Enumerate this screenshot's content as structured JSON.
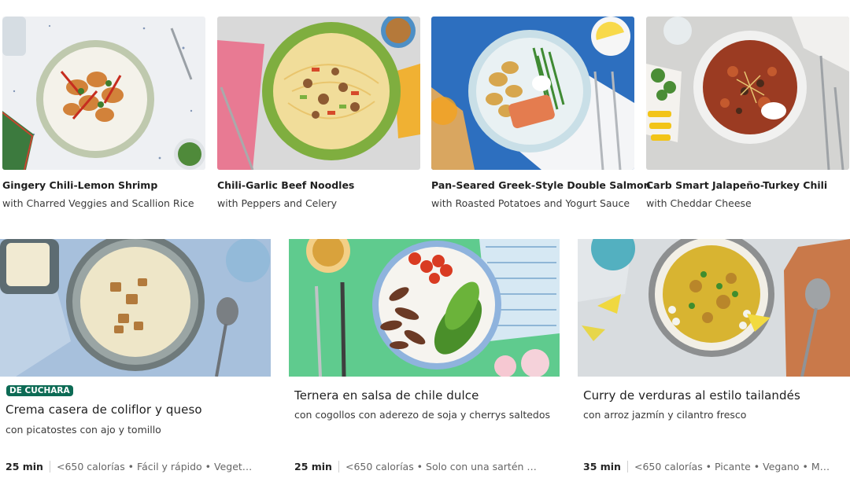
{
  "top_recipes": [
    {
      "title": "Gingery Chili-Lemon Shrimp",
      "subtitle": "with Charred Veggies and Scallion Rice"
    },
    {
      "title": "Chili-Garlic Beef Noodles",
      "subtitle": "with Peppers and Celery"
    },
    {
      "title": "Pan-Seared Greek-Style Double Salmon",
      "subtitle": "with Roasted Potatoes and Yogurt Sauce"
    },
    {
      "title": "Carb Smart Jalapeño-Turkey Chili",
      "subtitle": "with Cheddar Cheese"
    }
  ],
  "bottom_recipes": [
    {
      "badge": "DE CUCHARA",
      "title": "Crema casera de coliflor y queso",
      "subtitle": "con picatostes con ajo y tomillo",
      "time": "25 min",
      "tags": "<650 calorías • Fácil y rápido • Veget…"
    },
    {
      "title": "Ternera en salsa de chile dulce",
      "subtitle": "con cogollos con aderezo de soja y cherrys saltedos",
      "time": "25 min",
      "tags": "<650 calorías • Solo con una sartén …"
    },
    {
      "title": "Curry de verduras al estilo tailandés",
      "subtitle": "con arroz jazmín y cilantro fresco",
      "time": "35 min",
      "tags": "<650 calorías • Picante • Vegano • M…"
    }
  ],
  "colors": {
    "badge_bg": "#0d6b55",
    "text": "#242424"
  }
}
